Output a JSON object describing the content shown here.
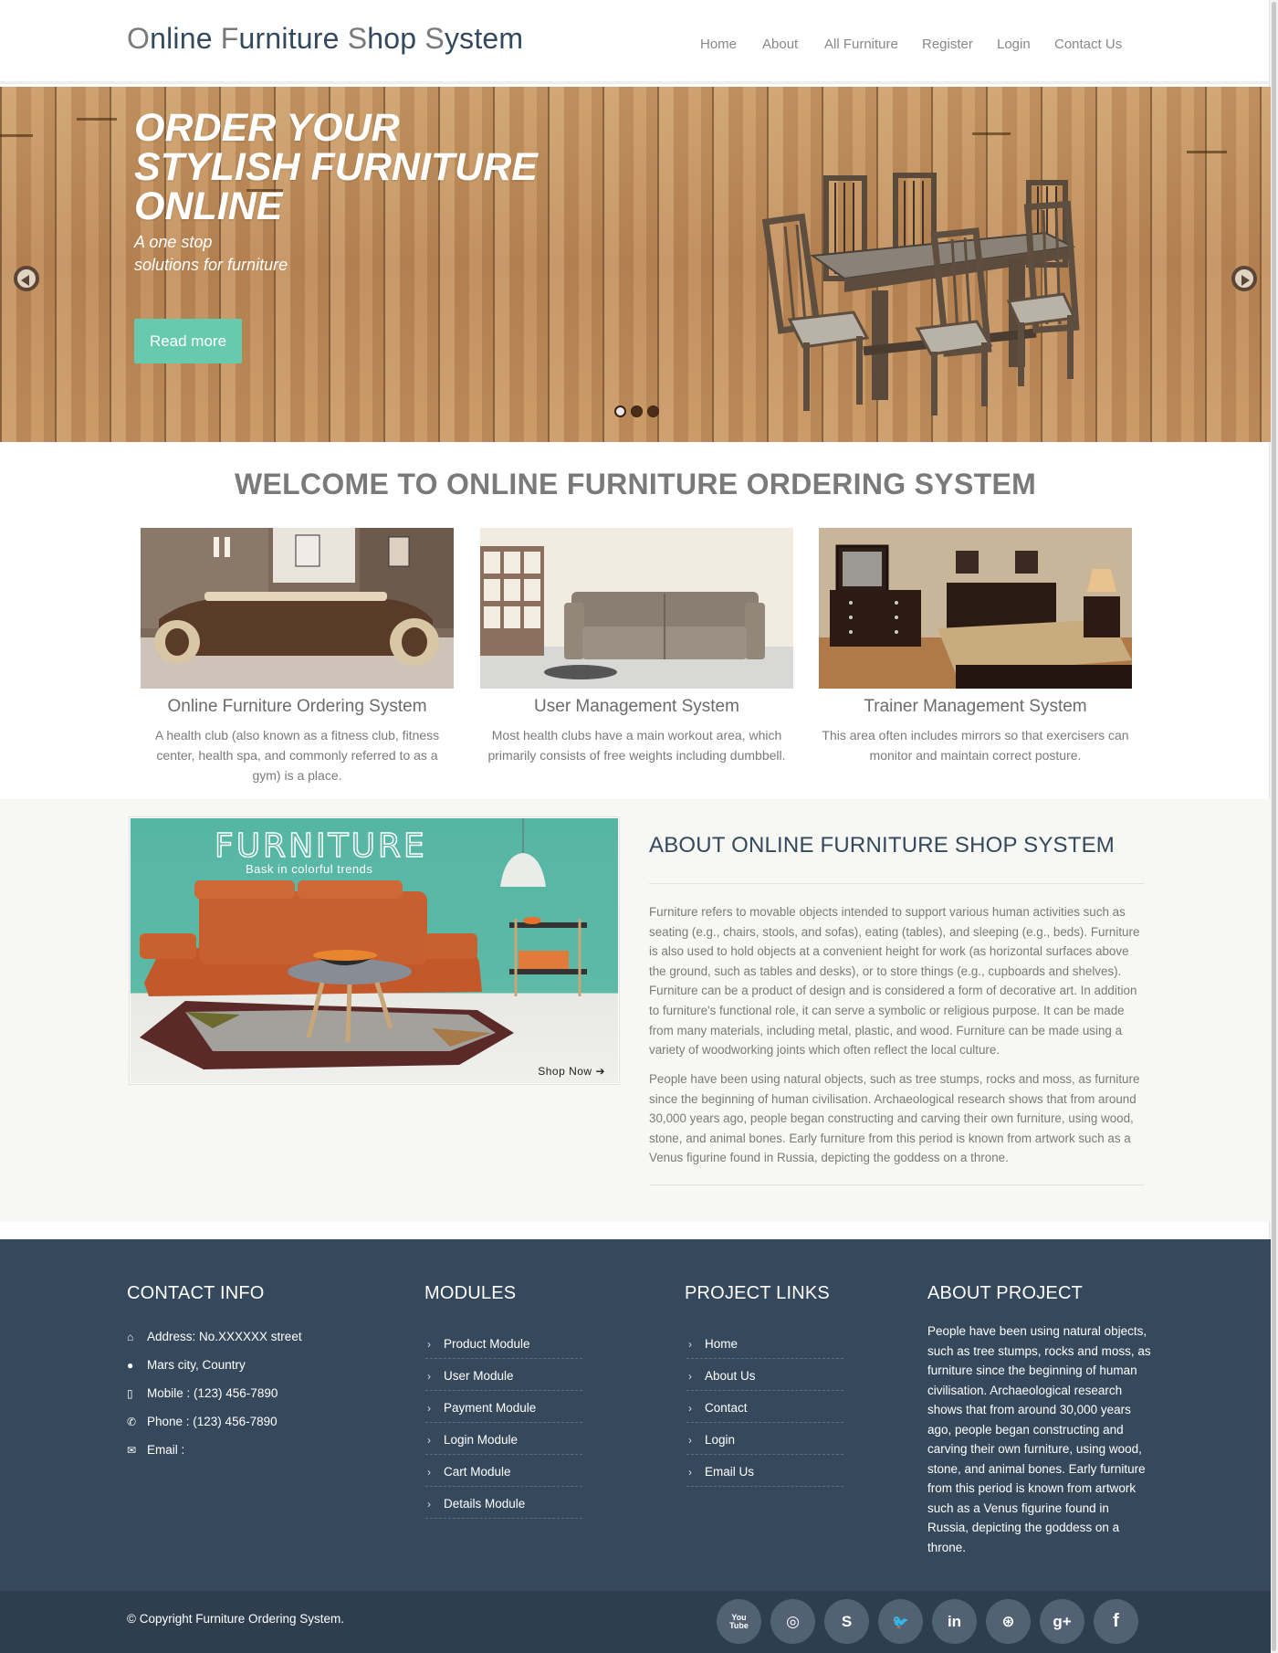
{
  "header": {
    "logo": [
      {
        "cap": "O",
        "rest": "nline "
      },
      {
        "cap": "F",
        "rest": "urniture "
      },
      {
        "cap": "S",
        "rest": "hop "
      },
      {
        "cap": "S",
        "rest": "ystem"
      }
    ],
    "nav": [
      "Home",
      "About",
      "All Furniture",
      "Register",
      "Login",
      "Contact Us"
    ]
  },
  "hero": {
    "title": "ORDER YOUR\nSTYLISH FURNITURE\nONLINE",
    "subtitle": "A one stop\nsolutions for furniture",
    "button": "Read more",
    "slides": 3,
    "active_slide": 1,
    "button_color": "#67c9ae"
  },
  "welcome": {
    "title": "WELCOME TO ONLINE FURNITURE ORDERING SYSTEM",
    "features": [
      {
        "title": "Online Furniture Ordering System",
        "text": "A health club (also known as a fitness club, fitness center, health spa, and commonly referred to as a gym) is a place."
      },
      {
        "title": "User Management System",
        "text": "Most health clubs have a main workout area, which primarily consists of free weights including dumbbell."
      },
      {
        "title": "Trainer Management System",
        "text": "This area often includes mirrors so that exercisers can monitor and maintain correct posture."
      }
    ]
  },
  "about": {
    "banner": {
      "title": "FURNITURE",
      "subtitle": "Bask in colorful trends",
      "cta": "Shop Now"
    },
    "heading": "ABOUT ONLINE FURNITURE SHOP SYSTEM",
    "paragraphs": [
      "Furniture refers to movable objects intended to support various human activities such as seating (e.g., chairs, stools, and sofas), eating (tables), and sleeping (e.g., beds). Furniture is also used to hold objects at a convenient height for work (as horizontal surfaces above the ground, such as tables and desks), or to store things (e.g., cupboards and shelves). Furniture can be a product of design and is considered a form of decorative art. In addition to furniture's functional role, it can serve a symbolic or religious purpose. It can be made from many materials, including metal, plastic, and wood. Furniture can be made using a variety of woodworking joints which often reflect the local culture.",
      "People have been using natural objects, such as tree stumps, rocks and moss, as furniture since the beginning of human civilisation. Archaeological research shows that from around 30,000 years ago, people began constructing and carving their own furniture, using wood, stone, and animal bones. Early furniture from this period is known from artwork such as a Venus figurine found in Russia, depicting the goddess on a throne."
    ]
  },
  "footer": {
    "contact": {
      "heading": "CONTACT INFO",
      "items": [
        {
          "icon": "home-icon",
          "text": "Address: No.XXXXXX street"
        },
        {
          "icon": "globe-icon",
          "text": "Mars city, Country"
        },
        {
          "icon": "mobile-icon",
          "text": "Mobile : (123) 456-7890"
        },
        {
          "icon": "phone-icon",
          "text": "Phone : (123) 456-7890"
        },
        {
          "icon": "envelope-icon",
          "text": "Email :"
        }
      ]
    },
    "modules": {
      "heading": "MODULES",
      "items": [
        "Product Module",
        "User Module",
        "Payment Module",
        "Login Module",
        "Cart Module",
        "Details Module"
      ]
    },
    "project_links": {
      "heading": "PROJECT LINKS",
      "items": [
        "Home",
        "About Us",
        "Contact",
        "Login",
        "Email Us"
      ]
    },
    "about_project": {
      "heading": "ABOUT PROJECT",
      "text": "People have been using natural objects, such as tree stumps, rocks and moss, as furniture since the beginning of human civilisation. Archaeological research shows that from around 30,000 years ago, people began constructing and carving their own furniture, using wood, stone, and animal bones. Early furniture from this period is known from artwork such as a Venus figurine found in Russia, depicting the goddess on a throne."
    },
    "copyright": "© Copyright Furniture Ordering System.",
    "socials": [
      {
        "name": "youtube-icon",
        "glyph": "You\nTube"
      },
      {
        "name": "github-icon",
        "glyph": "◎"
      },
      {
        "name": "skype-icon",
        "glyph": "S"
      },
      {
        "name": "twitter-icon",
        "glyph": "🐦"
      },
      {
        "name": "linkedin-icon",
        "glyph": "in"
      },
      {
        "name": "dribbble-icon",
        "glyph": "⊛"
      },
      {
        "name": "google-plus-icon",
        "glyph": "g+"
      },
      {
        "name": "facebook-icon",
        "glyph": "f"
      }
    ]
  }
}
